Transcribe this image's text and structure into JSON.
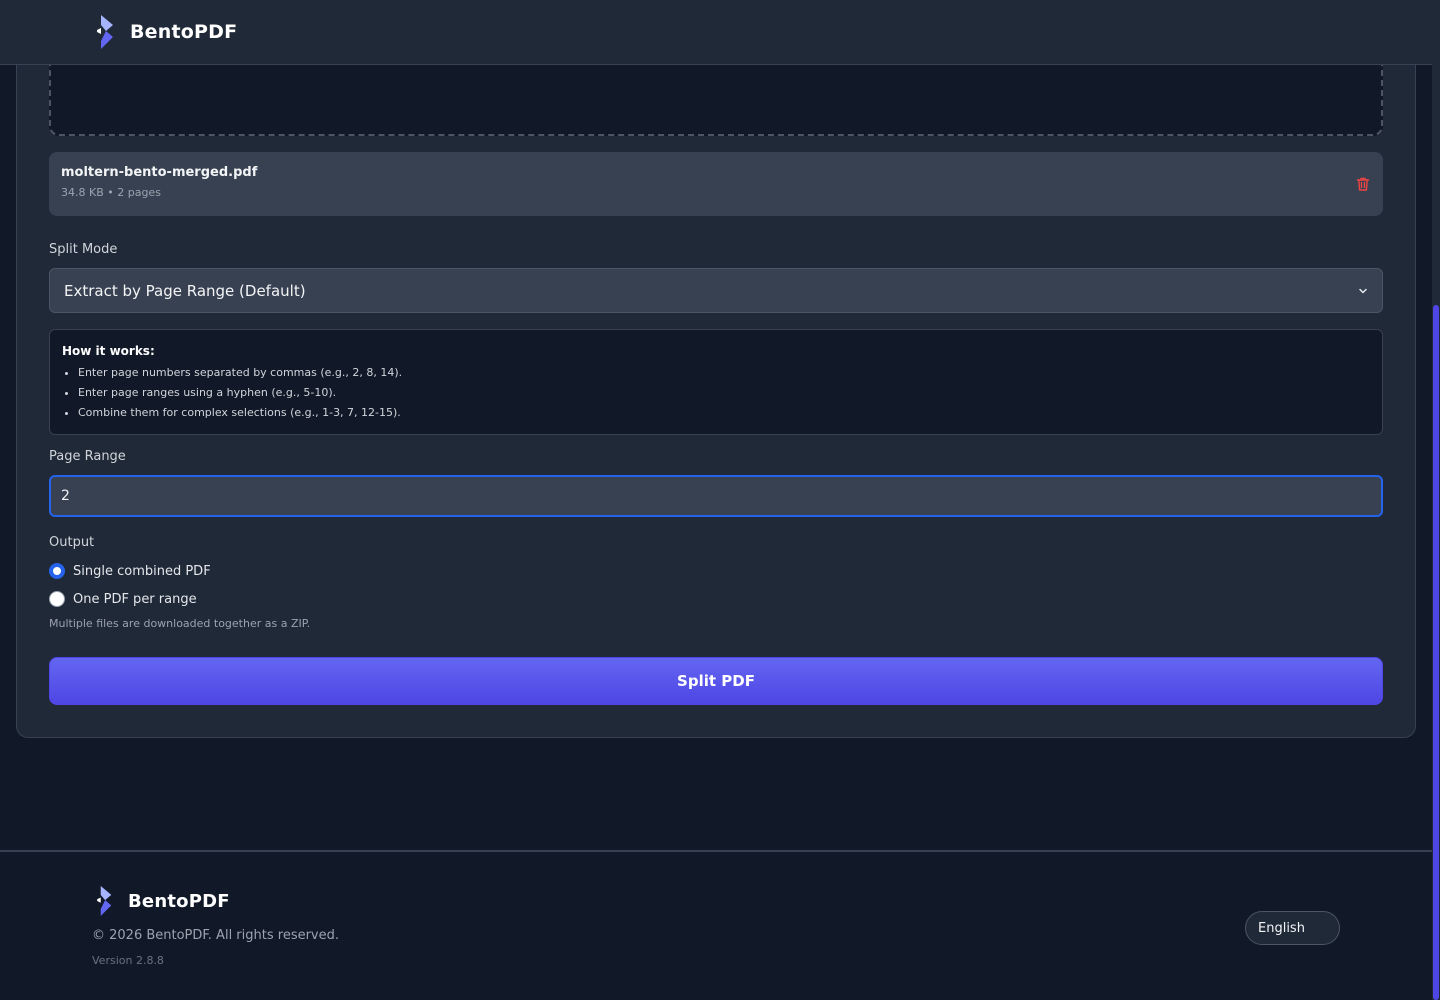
{
  "app": {
    "name": "BentoPDF"
  },
  "file": {
    "name": "moltern-bento-merged.pdf",
    "meta": "34.8 KB • 2 pages"
  },
  "split_mode": {
    "label": "Split Mode",
    "selected": "Extract by Page Range (Default)"
  },
  "howto": {
    "title": "How it works:",
    "items": [
      "Enter page numbers separated by commas (e.g., 2, 8, 14).",
      "Enter page ranges using a hyphen (e.g., 5-10).",
      "Combine them for complex selections (e.g., 1-3, 7, 12-15)."
    ]
  },
  "page_range": {
    "label": "Page Range",
    "value": "2"
  },
  "output": {
    "label": "Output",
    "options": [
      "Single combined PDF",
      "One PDF per range"
    ],
    "selected_index": 0,
    "hint": "Multiple files are downloaded together as a ZIP."
  },
  "split_button": "Split PDF",
  "footer": {
    "brand": "BentoPDF",
    "copyright": "© 2026 BentoPDF. All rights reserved.",
    "version": "Version 2.8.8",
    "language": "English"
  },
  "colors": {
    "accent": "#4f46e5",
    "focus": "#2563eb",
    "danger": "#ef4444",
    "background": "#111827",
    "surface": "#1f2937"
  },
  "icons": {
    "logo": "bento-logo-icon",
    "trash": "trash-icon",
    "chevron": "chevron-down-icon"
  }
}
